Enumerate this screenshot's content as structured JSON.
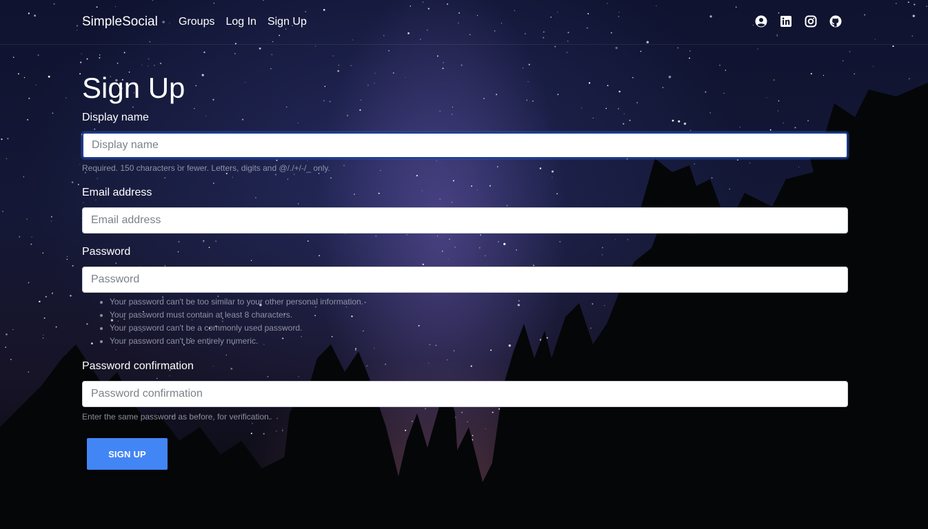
{
  "navbar": {
    "brand": "SimpleSocial",
    "links": [
      "Groups",
      "Log In",
      "Sign Up"
    ],
    "icons": [
      "account-circle-icon",
      "linkedin-icon",
      "instagram-icon",
      "github-icon"
    ]
  },
  "page": {
    "title": "Sign Up"
  },
  "form": {
    "display_name": {
      "label": "Display name",
      "placeholder": "Display name",
      "help": "Required. 150 characters or fewer. Letters, digits and @/./+/-/_ only."
    },
    "email": {
      "label": "Email address",
      "placeholder": "Email address"
    },
    "password": {
      "label": "Password",
      "placeholder": "Password",
      "help_items": [
        "Your password can't be too similar to your other personal information.",
        "Your password must contain at least 8 characters.",
        "Your password can't be a commonly used password.",
        "Your password can't be entirely numeric."
      ]
    },
    "password_confirmation": {
      "label": "Password confirmation",
      "placeholder": "Password confirmation",
      "help": "Enter the same password as before, for verification."
    },
    "submit_label": "SIGN UP"
  },
  "colors": {
    "button": "#4285f4",
    "focus_border": "#1f3f8f",
    "help_text": "#b4b9c8"
  }
}
